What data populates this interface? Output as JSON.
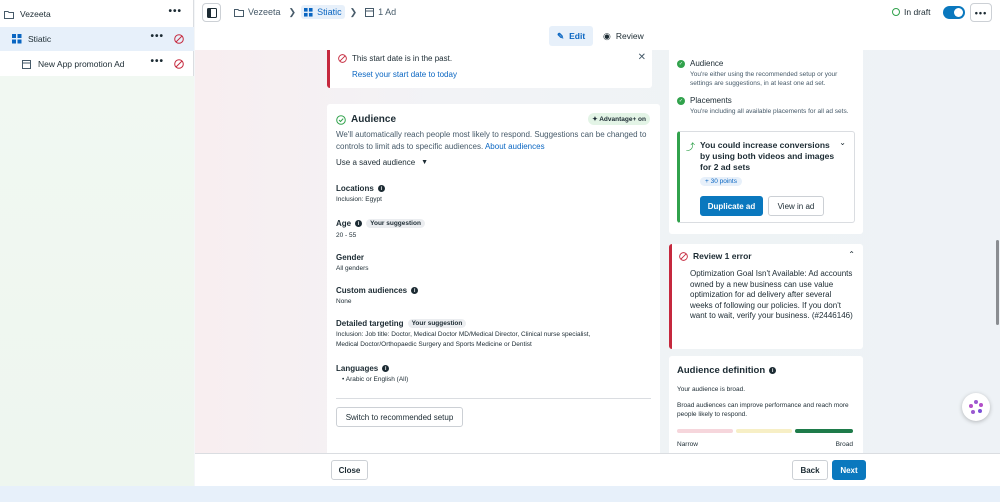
{
  "sidebar": {
    "campaign": {
      "label": "Vezeeta"
    },
    "adset": {
      "label": "Stiatic"
    },
    "ad": {
      "label": "New App promotion Ad"
    }
  },
  "topbar": {
    "breadcrumbs": [
      "Vezeeta",
      "Stiatic",
      "1 Ad"
    ],
    "status": "In draft"
  },
  "tabs": {
    "edit": "Edit",
    "review": "Review"
  },
  "warning": {
    "text": "This start date is in the past.",
    "link": "Reset your start date to today"
  },
  "audience": {
    "title": "Audience",
    "badge": "Advantage+ on",
    "description": "We'll automatically reach people most likely to respond. Suggestions can be changed to controls to limit ads to specific audiences.",
    "about_link": "About audiences",
    "saved_audience": "Use a saved audience",
    "locations_label": "Locations",
    "locations_value": "Inclusion: Egypt",
    "age_label": "Age",
    "age_badge": "Your suggestion",
    "age_value": "20 - 55",
    "gender_label": "Gender",
    "gender_value": "All genders",
    "custom_label": "Custom audiences",
    "custom_value": "None",
    "detailed_label": "Detailed targeting",
    "detailed_badge": "Your suggestion",
    "detailed_value_1": "Inclusion: Job title: Doctor, Medical Doctor MD/Medical Director, Clinical nurse specialist,",
    "detailed_value_2": "Medical Doctor/Orthopaedic Surgery and Sports Medicine or Dentist",
    "languages_label": "Languages",
    "languages_value": "Arabic or English (All)",
    "switch_button": "Switch to recommended setup"
  },
  "checks": {
    "audience_title": "Audience",
    "audience_sub": "You're either using the recommended setup or your settings are suggestions, in at least one ad set.",
    "placements_title": "Placements",
    "placements_sub": "You're including all available placements for all ad sets."
  },
  "conversion": {
    "title": "You could increase conversions by using both videos and images for 2 ad sets",
    "points": "+ 30 points",
    "duplicate_button": "Duplicate ad",
    "view_button": "View in ad"
  },
  "review": {
    "title": "Review 1 error",
    "text": "Optimization Goal Isn't Available: Ad accounts owned by a new business can use value optimization for ad delivery after several weeks of following our policies. If you don't want to wait, verify your business. (#2446146)"
  },
  "definition": {
    "title": "Audience definition",
    "text_1": "Your audience is broad.",
    "text_2": "Broad audiences can improve performance and reach more people likely to respond.",
    "narrow": "Narrow",
    "broad": "Broad",
    "level": "broad"
  },
  "footer": {
    "close": "Close",
    "back": "Back",
    "next": "Next"
  },
  "colors": {
    "accent": "#0a78be",
    "error": "#c5283d",
    "success": "#31a24c"
  }
}
